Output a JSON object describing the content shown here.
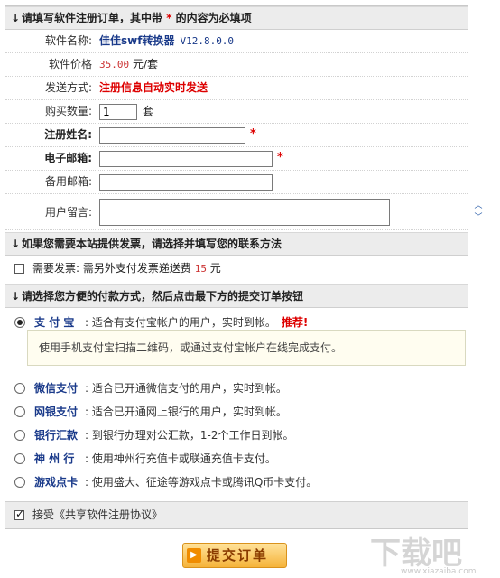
{
  "section1": {
    "arrow": "↓",
    "title_prefix": "请填写软件注册订单，其中带",
    "star": "*",
    "title_suffix": "的内容为必填项"
  },
  "fields": {
    "software_name_label": "软件名称:",
    "software_name": "佳佳swf转换器",
    "software_version": "V12.8.0.0",
    "price_label": "软件价格",
    "price_value": "35.00",
    "price_unit": "元/套",
    "ship_label": "发送方式:",
    "ship_value": "注册信息自动实时发送",
    "qty_label": "购买数量:",
    "qty_value": "1",
    "qty_unit": "套",
    "name_label": "注册姓名:",
    "name_value": "",
    "email_label": "电子邮箱:",
    "email_value": "",
    "alt_email_label": "备用邮箱:",
    "alt_email_value": "",
    "message_label": "用户留言:",
    "message_value": "",
    "required_mark": "*"
  },
  "section2": {
    "arrow": "↓",
    "title": "如果您需要本站提供发票，请选择并填写您的联系方法",
    "invoice_label": "需要发票:",
    "invoice_desc": "需另外支付发票递送费",
    "invoice_fee": "15",
    "invoice_unit": "元"
  },
  "section3": {
    "arrow": "↓",
    "title": "请选择您方便的付款方式，然后点击最下方的提交订单按钮",
    "hint": "使用手机支付宝扫描二维码，或通过支付宝帐户在线完成支付。",
    "methods": [
      {
        "name": "支 付 宝",
        "desc": ": 适合有支付宝帐户的用户，实时到帐。",
        "recommend": "推荐!",
        "selected": true
      },
      {
        "name": "微信支付",
        "desc": ": 适合已开通微信支付的用户，实时到帐。",
        "selected": false
      },
      {
        "name": "网银支付",
        "desc": ": 适合已开通网上银行的用户，实时到帐。",
        "selected": false
      },
      {
        "name": "银行汇款",
        "desc": ": 到银行办理对公汇款，1-2个工作日到帐。",
        "selected": false
      },
      {
        "name": "神 州 行",
        "desc": ": 使用神州行充值卡或联通充值卡支付。",
        "selected": false
      },
      {
        "name": "游戏点卡",
        "desc": ": 使用盛大、征途等游戏点卡或腾讯Q币卡支付。",
        "selected": false
      }
    ]
  },
  "agreement": {
    "checked": true,
    "label": "接受《共享软件注册协议》"
  },
  "submit": {
    "label": "提交订单"
  },
  "watermark": {
    "text": "下载吧",
    "sub": "www.xiazaiba.com"
  }
}
